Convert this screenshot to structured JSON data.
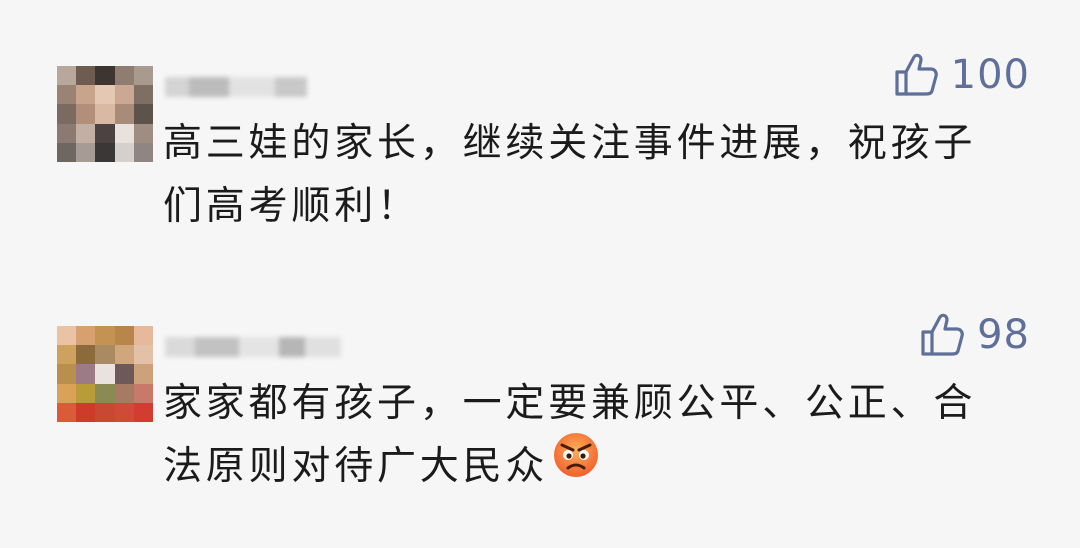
{
  "comments": [
    {
      "nickname": "",
      "likes": "100",
      "text": "高三娃的家长，继续关注事件进展，祝孩子们高考顺利！",
      "avatar_colors": [
        "#b8a89c",
        "#6d5c4f",
        "#3d3530",
        "#8e7d70",
        "#a89a8e",
        "#9a8275",
        "#c9a48d",
        "#e4c8b4",
        "#caa893",
        "#7f6e63",
        "#7a6a60",
        "#b38e78",
        "#d9b9a4",
        "#a88b78",
        "#5e524c",
        "#8a7a72",
        "#c2b0a4",
        "#4a4341",
        "#e8e2dc",
        "#9f8d82",
        "#6e6661",
        "#a79c95",
        "#3a3737",
        "#d5d0cc",
        "#8f8581"
      ]
    },
    {
      "nickname": "",
      "likes": "98",
      "text": "家家都有孩子，一定要兼顾公平、公正、合法原则对待广大民众",
      "emoji": "angry-face",
      "avatar_colors": [
        "#e9c3a4",
        "#d7a06f",
        "#c49353",
        "#b8864a",
        "#e6b99d",
        "#cfa15f",
        "#8c6a3b",
        "#a98a63",
        "#d0a77c",
        "#e2c1a6",
        "#b98f4e",
        "#9c7a86",
        "#e9e2df",
        "#6d5a58",
        "#cda27a",
        "#d9a259",
        "#b89c3a",
        "#8b8a52",
        "#a77a64",
        "#c77a6a",
        "#d95b3a",
        "#cf3b2a",
        "#c94833",
        "#d04a38",
        "#d33d31"
      ]
    }
  ],
  "colors": {
    "background": "#f6f6f6",
    "like_blue": "#5e6f9a",
    "text": "#1b1b1b"
  },
  "icons": {
    "like": "thumbs-up-icon"
  }
}
